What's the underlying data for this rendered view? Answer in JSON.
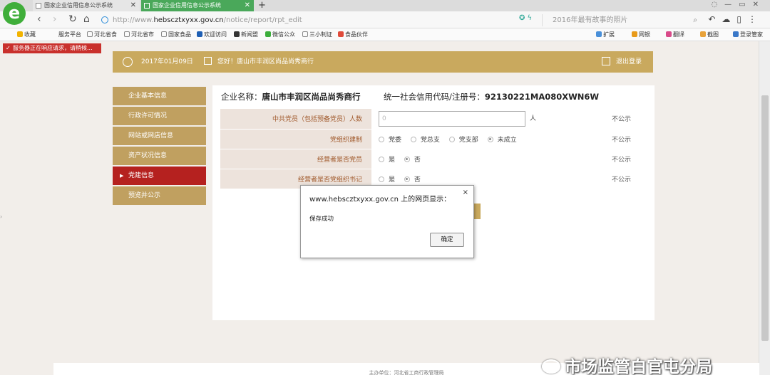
{
  "browser": {
    "tabs": [
      {
        "label": "国家企业信用信息公示系统",
        "active": false
      },
      {
        "label": "国家企业信用信息公示系统",
        "active": true
      }
    ],
    "url_prefix": "http://www.",
    "url_domain": "hebscztxyxx.gov.cn",
    "url_path": "/notice/report/rpt_edit",
    "search_placeholder": "2016年最有故事的照片",
    "bookmarks": [
      "收藏",
      "服务平台",
      "河北省食",
      "河北省市",
      "国家食品",
      "欢迎访问",
      "新闻盟",
      "微信公众",
      "三小制证",
      "食品伙伴",
      "扩展",
      "网银",
      "翻译",
      "截图",
      "登录管家"
    ],
    "status_banner": "服务器正在响应请求，请稍候..."
  },
  "header": {
    "date": "2017年01月09日",
    "greeting": "您好！唐山市丰润区尚品尚秀商行",
    "logout": "退出登录"
  },
  "sidebar": {
    "items": [
      {
        "label": "企业基本信息",
        "active": false
      },
      {
        "label": "行政许可情况",
        "active": false
      },
      {
        "label": "网站或网店信息",
        "active": false
      },
      {
        "label": "资产状况信息",
        "active": false
      },
      {
        "label": "党建信息",
        "active": true
      },
      {
        "label": "预览并公示",
        "active": false
      }
    ]
  },
  "company": {
    "name_label": "企业名称：",
    "name": "唐山市丰润区尚品尚秀商行",
    "credit_label": "统一社会信用代码/注册号：",
    "credit_code": "92130221MA080XWN6W"
  },
  "form": {
    "rows": [
      {
        "label": "中共党员（包括预备党员）人数",
        "input_value": "0",
        "unit": "人",
        "publicity": "不公示"
      },
      {
        "label": "党组织建制",
        "options": [
          "党委",
          "党总支",
          "党支部",
          "未成立"
        ],
        "selected": "未成立",
        "publicity": "不公示"
      },
      {
        "label": "经营者是否党员",
        "options": [
          "是",
          "否"
        ],
        "selected": "否",
        "publicity": "不公示"
      },
      {
        "label": "经营者是否党组织书记",
        "options": [
          "是",
          "否"
        ],
        "selected": "否",
        "publicity": "不公示"
      }
    ]
  },
  "dialog": {
    "title": "www.hebscztxyxx.gov.cn 上的网页显示：",
    "message": "保存成功",
    "ok_label": "确定",
    "close_symbol": "×"
  },
  "footer": {
    "text": "主办单位：河北省工商行政管理局"
  },
  "watermark": "市场监管白官屯分局",
  "colors": {
    "gold": "#c9a95e",
    "sidebar": "#c0a060",
    "active_red": "#b5211f",
    "label_bg": "#ede3dc",
    "label_text": "#a0582a",
    "tab_green": "#4aa85a"
  }
}
